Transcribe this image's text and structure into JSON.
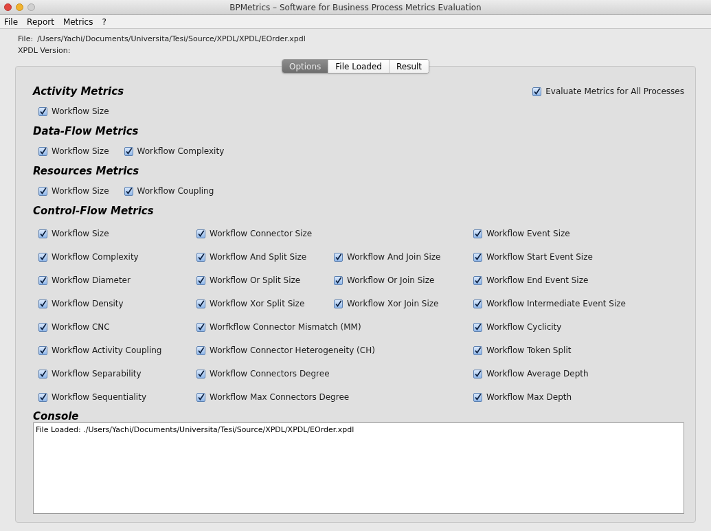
{
  "window": {
    "title": "BPMetrics – Software for Business Process Metrics Evaluation"
  },
  "menu": [
    "File",
    "Report",
    "Metrics",
    "?"
  ],
  "file_info": [
    {
      "label": "File:",
      "value": "/Users/Yachi/Documents/Universita/Tesi/Source/XPDL/XPDL/EOrder.xpdl"
    },
    {
      "label": "XPDL Version:"
    }
  ],
  "tabs": [
    {
      "label": "Options",
      "selected": true
    },
    {
      "label": "File Loaded",
      "selected": false
    },
    {
      "label": "Result",
      "selected": false
    }
  ],
  "evaluate_all": {
    "label": "Evaluate Metrics for All Processes",
    "checked": true
  },
  "groups": [
    {
      "title": "Activity Metrics",
      "items": [
        {
          "label": "Workflow Size",
          "checked": true
        }
      ]
    },
    {
      "title": "Data-Flow Metrics",
      "items": [
        {
          "label": "Workflow Size",
          "checked": true
        },
        {
          "label": "Workflow Complexity",
          "checked": true
        }
      ]
    },
    {
      "title": "Resources Metrics",
      "items": [
        {
          "label": "Workflow Size",
          "checked": true
        },
        {
          "label": "Workflow Coupling",
          "checked": true
        }
      ]
    }
  ],
  "control_flow": {
    "title": "Control-Flow Metrics",
    "rows": [
      [
        {
          "kind": "checkbox",
          "label": "Workflow Size",
          "checked": true
        },
        {
          "kind": "checkbox",
          "label": "Workflow Connector Size",
          "checked": true
        },
        {
          "kind": "gap"
        },
        {
          "kind": "checkbox",
          "label": "Workflow Event Size",
          "checked": true
        }
      ],
      [
        {
          "kind": "checkbox",
          "label": "Workflow Complexity",
          "checked": true
        },
        {
          "kind": "checkbox",
          "label": "Workflow And Split Size",
          "checked": true
        },
        {
          "kind": "checkbox",
          "label": "Workflow And Join Size",
          "checked": true
        },
        {
          "kind": "checkbox",
          "label": "Workflow Start Event Size",
          "checked": true
        }
      ],
      [
        {
          "kind": "checkbox",
          "label": "Workflow Diameter",
          "checked": true
        },
        {
          "kind": "checkbox",
          "label": "Workflow Or Split Size",
          "checked": true
        },
        {
          "kind": "checkbox",
          "label": "Workflow Or Join Size",
          "checked": true
        },
        {
          "kind": "checkbox",
          "label": "Workflow End Event Size",
          "checked": true
        }
      ],
      [
        {
          "kind": "checkbox",
          "label": "Workflow Density",
          "checked": true
        },
        {
          "kind": "checkbox",
          "label": "Workflow Xor Split Size",
          "checked": true
        },
        {
          "kind": "checkbox",
          "label": "Workflow Xor Join Size",
          "checked": true
        },
        {
          "kind": "checkbox",
          "label": "Workflow Intermediate Event Size",
          "checked": true
        }
      ],
      [
        {
          "kind": "checkbox",
          "label": "Workflow CNC",
          "checked": true
        },
        {
          "kind": "checkbox",
          "label": "Worfkflow Connector Mismatch (MM)",
          "checked": true
        },
        {
          "kind": "gap"
        },
        {
          "kind": "checkbox",
          "label": "Workflow Cyclicity",
          "checked": true
        }
      ],
      [
        {
          "kind": "checkbox",
          "label": "Workflow Activity Coupling",
          "checked": true
        },
        {
          "kind": "checkbox",
          "label": "Workflow Connector Heterogeneity (CH)",
          "checked": true
        },
        {
          "kind": "gap"
        },
        {
          "kind": "checkbox",
          "label": "Workflow Token Split",
          "checked": true
        }
      ],
      [
        {
          "kind": "checkbox",
          "label": "Workflow Separability",
          "checked": true
        },
        {
          "kind": "checkbox",
          "label": "Workflow Connectors Degree",
          "checked": true
        },
        {
          "kind": "gap"
        },
        {
          "kind": "checkbox",
          "label": "Workflow Average Depth",
          "checked": true
        }
      ],
      [
        {
          "kind": "checkbox",
          "label": "Workflow Sequentiality",
          "checked": true
        },
        {
          "kind": "checkbox",
          "label": "Workflow Max Connectors Degree",
          "checked": true
        },
        {
          "kind": "gap"
        },
        {
          "kind": "checkbox",
          "label": "Workflow Max Depth",
          "checked": true
        }
      ]
    ]
  },
  "console": {
    "title": "Console",
    "text": "File Loaded: ./Users/Yachi/Documents/Universita/Tesi/Source/XPDL/XPDL/EOrder.xpdl"
  }
}
